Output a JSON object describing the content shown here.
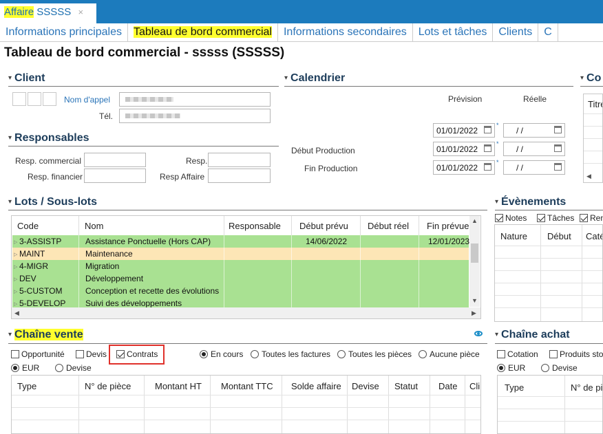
{
  "window": {
    "doc_tab_prefix": "Affaire",
    "doc_tab_code": "SSSSS",
    "close_glyph": "×"
  },
  "tabs": [
    "Informations principales",
    "Tableau de bord commercial",
    "Informations secondaires",
    "Lots et tâches",
    "Clients",
    "C"
  ],
  "active_tab": 1,
  "page_title": "Tableau de bord commercial - sssss (SSSSS)",
  "client": {
    "section": "Client",
    "nom_appel_label": "Nom d'appel",
    "tel_label": "Tél."
  },
  "responsables": {
    "section": "Responsables",
    "resp_commercial": "Resp. commercial",
    "resp": "Resp.",
    "resp_financier": "Resp. financier",
    "resp_affaire": "Resp Affaire"
  },
  "calendrier": {
    "section": "Calendrier",
    "prevision": "Prévision",
    "reelle": "Réelle",
    "debut_production": "Début Production",
    "fin_production": "Fin Production",
    "dates": [
      "01/01/2022",
      "01/01/2022",
      "01/01/2022"
    ],
    "empty_date": " /  / ",
    "required_mark": "*"
  },
  "co_section": "Co",
  "co_header": "Titre",
  "lots": {
    "section": "Lots / Sous-lots",
    "columns": [
      "Code",
      "Nom",
      "Responsable",
      "Début prévu",
      "Début réel",
      "Fin prévue"
    ],
    "rows": [
      {
        "code": "3-ASSISTP",
        "nom": "Assistance Ponctuelle (Hors CAP)",
        "resp": "",
        "debut_prevu": "14/06/2022",
        "debut_reel": "",
        "fin_prevue": "12/01/2023",
        "color": "#a9e192"
      },
      {
        "code": "MAINT",
        "nom": "Maintenance",
        "resp": "",
        "debut_prevu": "",
        "debut_reel": "",
        "fin_prevue": "",
        "color": "#fde6b6"
      },
      {
        "code": "4-MIGR",
        "nom": "Migration",
        "resp": "",
        "debut_prevu": "",
        "debut_reel": "",
        "fin_prevue": "",
        "color": "#a9e192"
      },
      {
        "code": "DEV",
        "nom": "Développement",
        "resp": "",
        "debut_prevu": "",
        "debut_reel": "",
        "fin_prevue": "",
        "color": "#a9e192"
      },
      {
        "code": "5-CUSTOM",
        "nom": "Conception et recette des évolutions",
        "resp": "",
        "debut_prevu": "",
        "debut_reel": "",
        "fin_prevue": "",
        "color": "#a9e192"
      },
      {
        "code": "5-DEVELOP",
        "nom": "Suivi des développements",
        "resp": "",
        "debut_prevu": "",
        "debut_reel": "",
        "fin_prevue": "",
        "color": "#a9e192"
      }
    ]
  },
  "evenements": {
    "section": "Évènements",
    "filters": [
      {
        "label": "Notes",
        "checked": true
      },
      {
        "label": "Tâches",
        "checked": true
      },
      {
        "label": "Ren",
        "checked": true
      }
    ],
    "columns": [
      "Nature",
      "Début",
      "Caté"
    ]
  },
  "chaine_vente": {
    "section": "Chaîne vente",
    "checks": [
      {
        "label": "Opportunité",
        "checked": false
      },
      {
        "label": "Devis",
        "checked": false
      },
      {
        "label": "Contrats",
        "checked": true
      }
    ],
    "radios": [
      {
        "label": "En cours",
        "checked": true
      },
      {
        "label": "Toutes les factures",
        "checked": false
      },
      {
        "label": "Toutes les pièces",
        "checked": false
      },
      {
        "label": "Aucune pièce",
        "checked": false
      }
    ],
    "currency": [
      {
        "label": "EUR",
        "checked": true
      },
      {
        "label": "Devise",
        "checked": false
      }
    ],
    "columns": [
      "Type",
      "N° de pièce",
      "Montant HT",
      "Montant TTC",
      "Solde affaire",
      "Devise",
      "Statut",
      "Date",
      "Cli"
    ]
  },
  "chaine_achat": {
    "section": "Chaîne achat",
    "checks": [
      {
        "label": "Cotation",
        "checked": false
      },
      {
        "label": "Produits stoc",
        "checked": false
      }
    ],
    "currency": [
      {
        "label": "EUR",
        "checked": true
      },
      {
        "label": "Devise",
        "checked": false
      }
    ],
    "columns": [
      "Type",
      "N° de pi"
    ]
  },
  "colors": {
    "accent_bar": "#1c7bbd",
    "highlight": "#ffff2e",
    "row_green": "#a9e192",
    "row_orange": "#fde6b6",
    "red_box": "#e0302a"
  }
}
